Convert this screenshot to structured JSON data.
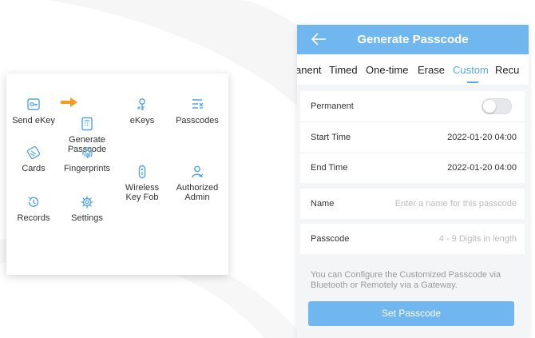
{
  "colors": {
    "accent": "#55a8ea",
    "header": "#6fb7ee",
    "arrow": "#f59a23",
    "icon": "#4fa3e6"
  },
  "menu": {
    "items": [
      {
        "label": "Send eKey",
        "icon": "send-ekey-icon"
      },
      {
        "label": "Generate\nPasscode",
        "icon": "generate-passcode-icon"
      },
      {
        "label": "eKeys",
        "icon": "ekeys-icon"
      },
      {
        "label": "Passcodes",
        "icon": "passcodes-icon"
      },
      {
        "label": "Cards",
        "icon": "cards-icon"
      },
      {
        "label": "Fingerprints",
        "icon": "fingerprint-icon"
      },
      {
        "label": "Wireless\nKey Fob",
        "icon": "key-fob-icon"
      },
      {
        "label": "Authorized\nAdmin",
        "icon": "authorized-admin-icon"
      },
      {
        "label": "Records",
        "icon": "records-icon"
      },
      {
        "label": "Settings",
        "icon": "settings-icon"
      }
    ]
  },
  "phone": {
    "title": "Generate Passcode",
    "tabs": [
      "anent",
      "Timed",
      "One-time",
      "Erase",
      "Custom",
      "Recu"
    ],
    "active_tab": "Custom",
    "permanent": {
      "label": "Permanent",
      "enabled": false
    },
    "start_time": {
      "label": "Start Time",
      "value": "2022-01-20 04:00"
    },
    "end_time": {
      "label": "End Time",
      "value": "2022-01-20 04:00"
    },
    "name": {
      "label": "Name",
      "placeholder": "Enter a name for this passcode"
    },
    "passcode": {
      "label": "Passcode",
      "placeholder": "4 - 9 Digits in length"
    },
    "note": "You can Configure the Customized Passcode via Bluetooth or Remotely via a Gateway.",
    "button": "Set Passcode"
  }
}
